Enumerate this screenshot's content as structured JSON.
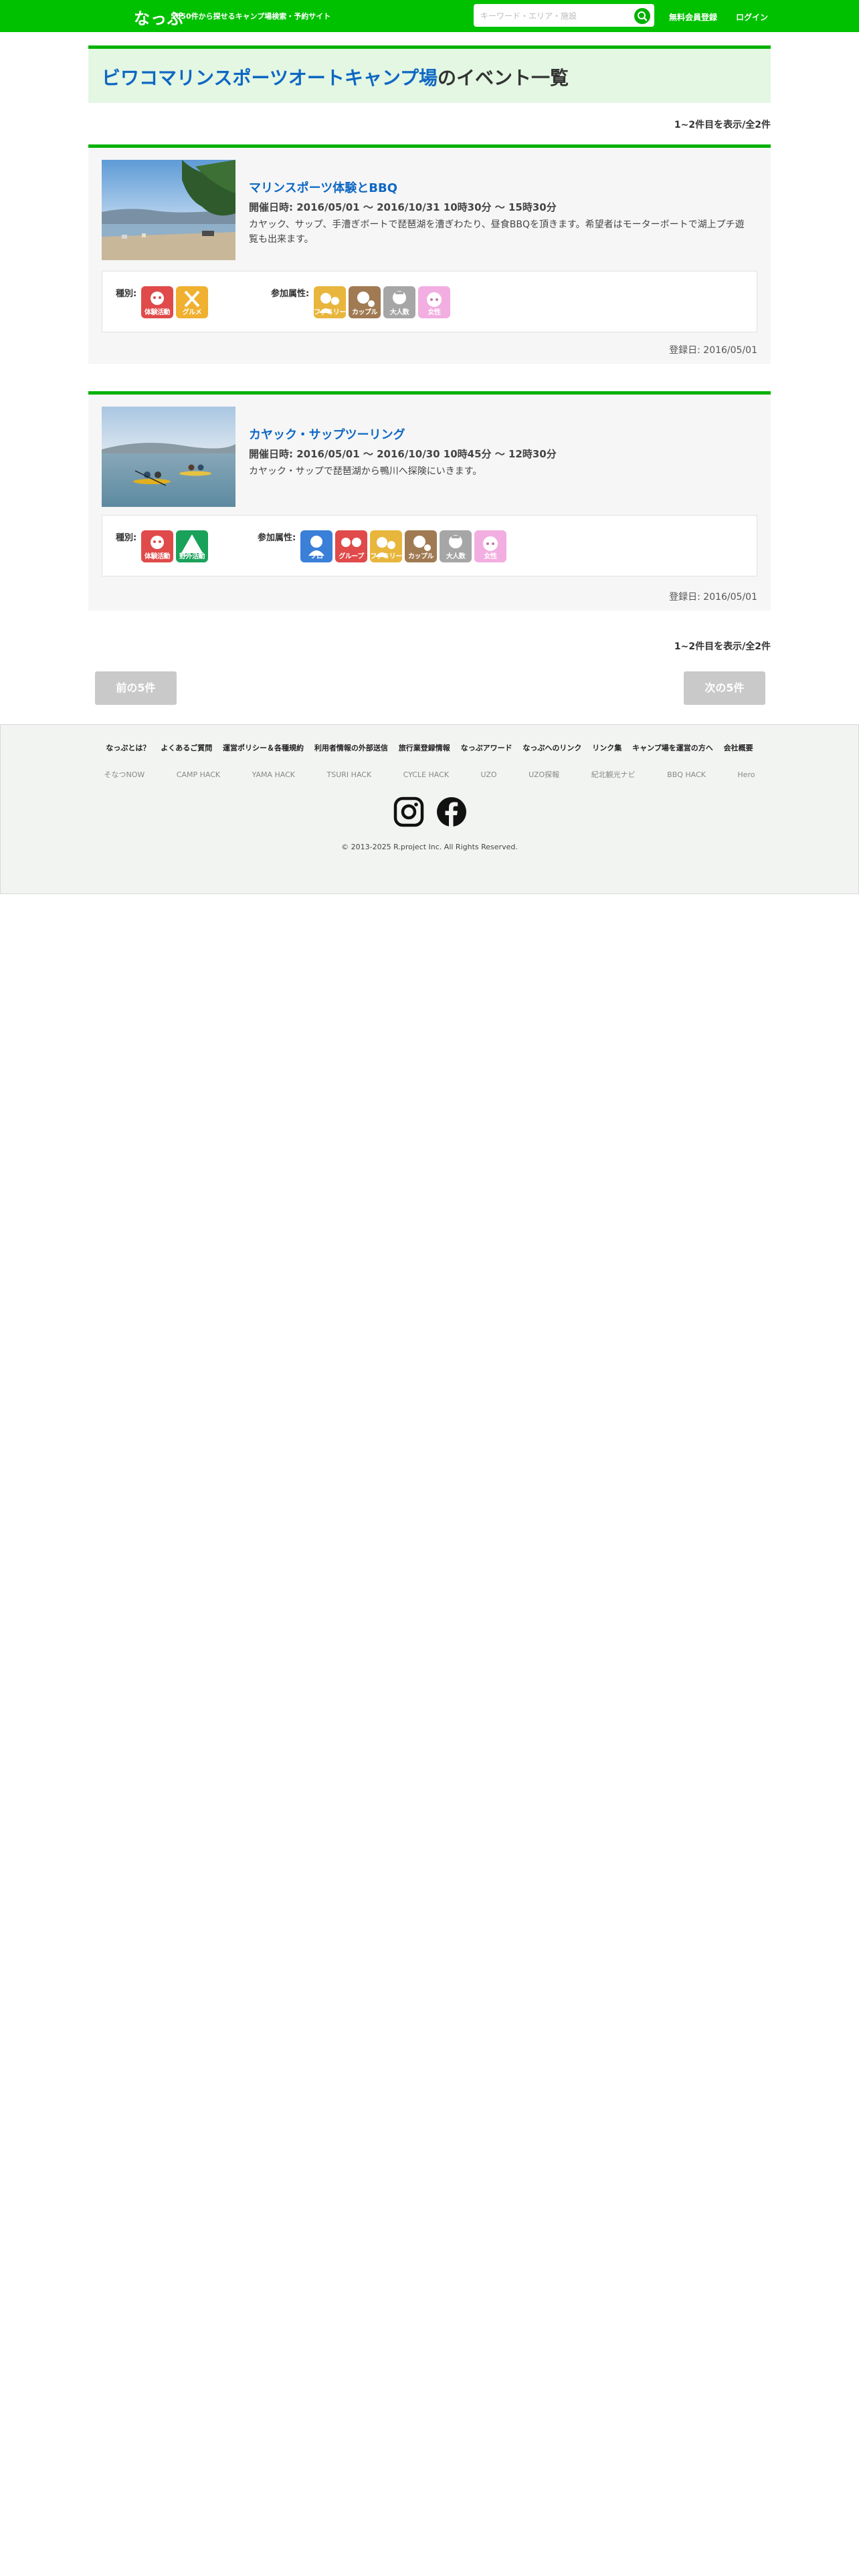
{
  "header": {
    "logo": "なっぷ",
    "tagline": "5650件から探せるキャンプ場検索・予約サイト",
    "search_placeholder": "キーワード・エリア・施設",
    "register": "無料会員登録",
    "login": "ログイン"
  },
  "page": {
    "site_name": "ビワコマリンスポーツオートキャンプ場",
    "title_suffix": "のイベント一覧",
    "count_text": "1~2件目を表示/全2件"
  },
  "events": [
    {
      "title": "マリンスポーツ体験とBBQ",
      "date": "開催日時: 2016/05/01 ～ 2016/10/31 10時30分 ～ 15時30分",
      "desc": "カヤック、サップ、手漕ぎボートで琵琶湖を漕ぎわたり、昼食BBQを頂きます。希望者はモーターボートで湖上プチ遊覧も出来ます。",
      "type_label": "種別:",
      "attr_label": "参加属性:",
      "types": [
        {
          "icon": "experience-icon",
          "label": "体験活動",
          "color": "#e04a4a"
        },
        {
          "icon": "gourmet-icon",
          "label": "グルメ",
          "color": "#f0b030"
        }
      ],
      "attrs": [
        {
          "icon": "family-icon",
          "label": "ファミリー",
          "color": "#e8b63c"
        },
        {
          "icon": "couple-icon",
          "label": "カップル",
          "color": "#a07a52"
        },
        {
          "icon": "adult-icon",
          "label": "大人数",
          "color": "#a6a6a6"
        },
        {
          "icon": "women-icon",
          "label": "女性",
          "color": "#f2aee0"
        }
      ],
      "registered": "登録日: 2016/05/01"
    },
    {
      "title": "カヤック・サップツーリング",
      "date": "開催日時: 2016/05/01 ～ 2016/10/30 10時45分 ～ 12時30分",
      "desc": "カヤック・サップで琵琶湖から鴨川へ探険にいきます。",
      "type_label": "種別:",
      "attr_label": "参加属性:",
      "types": [
        {
          "icon": "experience-icon",
          "label": "体験活動",
          "color": "#e04a4a"
        },
        {
          "icon": "outdoor-icon",
          "label": "野外活動",
          "color": "#1aa25a"
        }
      ],
      "attrs": [
        {
          "icon": "solo-icon",
          "label": "ソロ",
          "color": "#3a7fd8"
        },
        {
          "icon": "friends-icon",
          "label": "グループ",
          "color": "#e04a4a"
        },
        {
          "icon": "family-icon",
          "label": "ファミリー",
          "color": "#e8b63c"
        },
        {
          "icon": "couple-icon",
          "label": "カップル",
          "color": "#a07a52"
        },
        {
          "icon": "adult-icon",
          "label": "大人数",
          "color": "#a6a6a6"
        },
        {
          "icon": "women-icon",
          "label": "女性",
          "color": "#f2aee0"
        }
      ],
      "registered": "登録日: 2016/05/01"
    }
  ],
  "pagination": {
    "prev": "前の5件",
    "next": "次の5件"
  },
  "footer": {
    "nav": [
      "なっぷとは？",
      "よくあるご質問",
      "運営ポリシー＆各種規約",
      "利用者情報の外部送信",
      "旅行業登録情報",
      "なっぷアワード",
      "なっぷへのリンク",
      "リンク集",
      "キャンプ場を運営の方へ",
      "会社概要"
    ],
    "sites": [
      "そなつNOW",
      "CAMP HACK",
      "YAMA HACK",
      "TSURI HACK",
      "CYCLE HACK",
      "UZO",
      "UZO探報",
      "紀北観光ナビ",
      "BBQ HACK",
      "Hero"
    ],
    "copyright": "© 2013-2025 R.project Inc. All Rights Reserved."
  }
}
